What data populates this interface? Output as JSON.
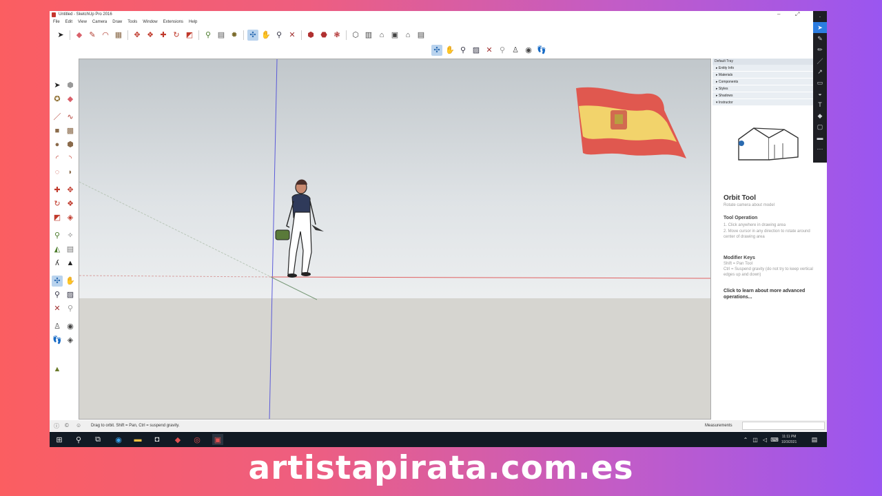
{
  "window": {
    "title": "Untitled - SketchUp Pro 2016",
    "controls": [
      "–",
      "⤢"
    ]
  },
  "menu": [
    "File",
    "Edit",
    "View",
    "Camera",
    "Draw",
    "Tools",
    "Window",
    "Extensions",
    "Help"
  ],
  "toolbar_top": [
    "select-icon",
    "eraser-icon",
    "pencil-icon",
    "arc-icon",
    "paint-bucket-icon",
    "push-pull-icon",
    "follow-me-icon",
    "move-icon",
    "rotate-icon",
    "scale-icon",
    "tape-measure-icon",
    "text-icon",
    "dimension-icon",
    "orbit-icon",
    "pan-icon",
    "zoom-icon",
    "zoom-extents-icon",
    "warehouse-icon",
    "extension-icon",
    "component-icon",
    "section-icon",
    "view-iso-icon",
    "view-top-icon",
    "view-front-icon",
    "view-right-icon",
    "view-back-icon"
  ],
  "toolbar_camera": [
    "orbit-icon",
    "pan-icon",
    "zoom-icon",
    "zoom-window-icon",
    "zoom-extents-icon",
    "previous-view-icon",
    "position-camera-icon",
    "look-around-icon",
    "walk-icon"
  ],
  "tray": {
    "header": "Default Tray",
    "panels": [
      "Entity Info",
      "Materials",
      "Components",
      "Styles",
      "Shadows",
      "Instructor"
    ],
    "instructor": {
      "tool_name": "Orbit Tool",
      "tool_desc": "Rotate camera about model",
      "op_heading": "Tool Operation",
      "op_1": "1.  Click anywhere in drawing area",
      "op_2": "2.  Move cursor in any direction to rotate around center of drawing area",
      "mod_heading": "Modifier Keys",
      "mod_1": "Shift = Pan Tool",
      "mod_2": "Ctrl = Suspend gravity (do not try to keep vertical edges up and down)",
      "link": "Click to learn about more advanced operations..."
    }
  },
  "status": {
    "message": "Drag to orbit. Shift = Pan, Ctrl = suspend gravity.",
    "measurements_label": "Measurements"
  },
  "taskbar": {
    "time": "11:11 PM",
    "date": "10/3/2021"
  },
  "watermark": "artistapirata.com.es",
  "colors": {
    "flag_red": "#e0584f",
    "flag_yellow": "#f2d36b",
    "selected_tool": "#b9d3ee",
    "dark_panel": "#1e1f24"
  }
}
